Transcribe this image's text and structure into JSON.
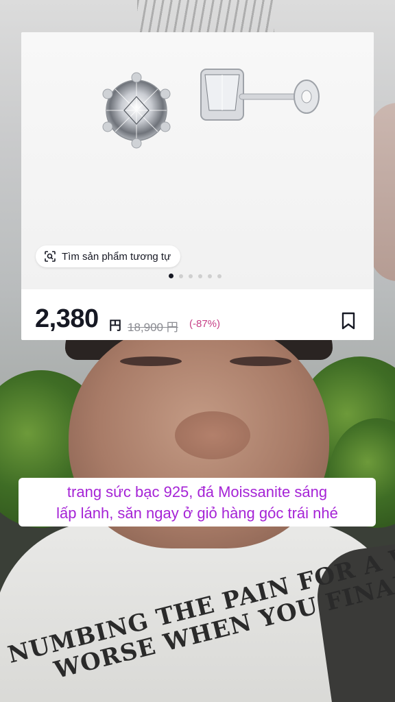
{
  "product": {
    "image_icons": [
      "earring-front-icon",
      "earring-side-icon"
    ],
    "similar_button_label": "Tìm sản phẩm tương tự",
    "image_count": 6,
    "active_image_index": 0,
    "price": "2,380",
    "currency": "円",
    "original_price": "18,900 円",
    "discount": "(-87%)"
  },
  "caption": {
    "line1": "trang sức bạc 925, đá Moissanite sáng",
    "line2": "lấp lánh, săn ngay ở giỏ hàng góc trái nhé"
  },
  "background": {
    "shirt_print_line1": "NUMBING THE PAIN FOR A WHILE WI",
    "shirt_print_line2": "WORSE WHEN YOU FINALITY F"
  },
  "colors": {
    "caption_text": "#a523d6",
    "discount_text": "#c63f86",
    "price_text": "#161823"
  }
}
